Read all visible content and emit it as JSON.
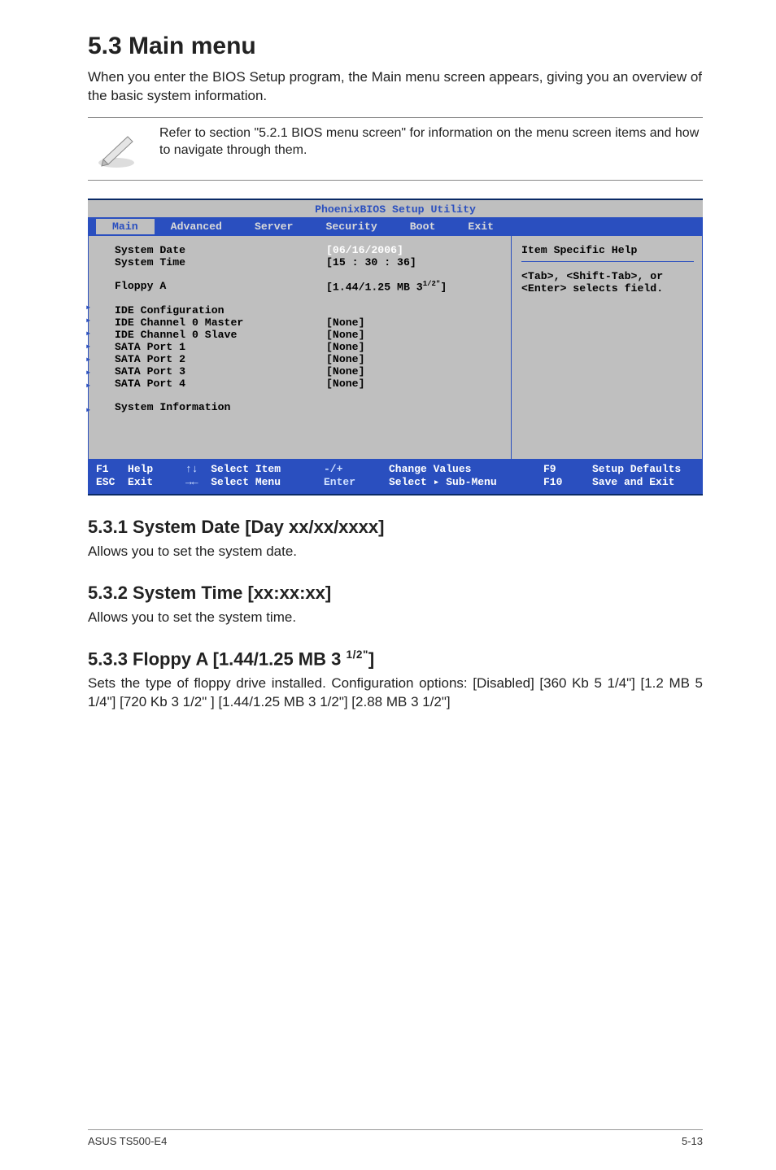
{
  "section": {
    "title": "5.3 Main menu",
    "intro": "When you enter the BIOS Setup program, the Main menu screen appears, giving you an overview of the basic system information.",
    "note": "Refer to section \"5.2.1 BIOS menu screen\" for information on the menu screen items and how to navigate through them."
  },
  "bios": {
    "title": "PhoenixBIOS Setup Utility",
    "tabs": [
      "Main",
      "Advanced",
      "Server",
      "Security",
      "Boot",
      "Exit"
    ],
    "active_tab": "Main",
    "rows": [
      {
        "label": "System Date",
        "value": "[06/16/2006]",
        "hl": true
      },
      {
        "label": "System Time",
        "value": "[15 : 30 : 36]"
      }
    ],
    "floppy": {
      "label": "Floppy A",
      "value": "[1.44/1.25 MB 3",
      "exp": "1/2\"",
      "close": "]"
    },
    "menu_items": [
      {
        "label": "IDE Configuration",
        "value": ""
      },
      {
        "label": "IDE Channel 0 Master",
        "value": "[None]"
      },
      {
        "label": "IDE Channel 0 Slave",
        "value": "[None]"
      },
      {
        "label": "SATA Port 1",
        "value": "[None]"
      },
      {
        "label": "SATA Port 2",
        "value": "[None]"
      },
      {
        "label": "SATA Port 3",
        "value": "[None]"
      },
      {
        "label": "SATA Port 4",
        "value": "[None]"
      }
    ],
    "sysinfo": "System Information",
    "help": {
      "title": "Item Specific Help",
      "line1": "<Tab>, <Shift-Tab>, or",
      "line2": "<Enter> selects field."
    },
    "footer": {
      "r1c1": "F1",
      "r1c1b": "Help",
      "r1c2a": "↑↓",
      "r1c2b": "Select Item",
      "r1c3": "-/+",
      "r1c4": "Change Values",
      "r1c5": "F9",
      "r1c6": "Setup Defaults",
      "r2c1": "ESC",
      "r2c1b": "Exit",
      "r2c2a": "→←",
      "r2c2b": "Select Menu",
      "r2c3": "Enter",
      "r2c4": "Select ▸ Sub-Menu",
      "r2c5": "F10",
      "r2c6": "Save and Exit"
    }
  },
  "subs": {
    "s1_title": "5.3.1 System Date [Day xx/xx/xxxx]",
    "s1_body": "Allows you to set the system date.",
    "s2_title": "5.3.2 System Time [xx:xx:xx]",
    "s2_body": "Allows you to set the system time.",
    "s3_title_a": "5.3.3 Floppy A [1.44/1.25 MB 3 ",
    "s3_title_frac": "1/2\"",
    "s3_title_b": "]",
    "s3_body": "Sets the type of floppy drive installed. Configuration options: [Disabled] [360 Kb  5 1/4\"] [1.2 MB  5 1/4\"] [720 Kb  3 1/2\" ] [1.44/1.25 MB 3 1/2\"] [2.88 MB  3 1/2\"]"
  },
  "footer": {
    "left": "ASUS TS500-E4",
    "right": "5-13"
  }
}
